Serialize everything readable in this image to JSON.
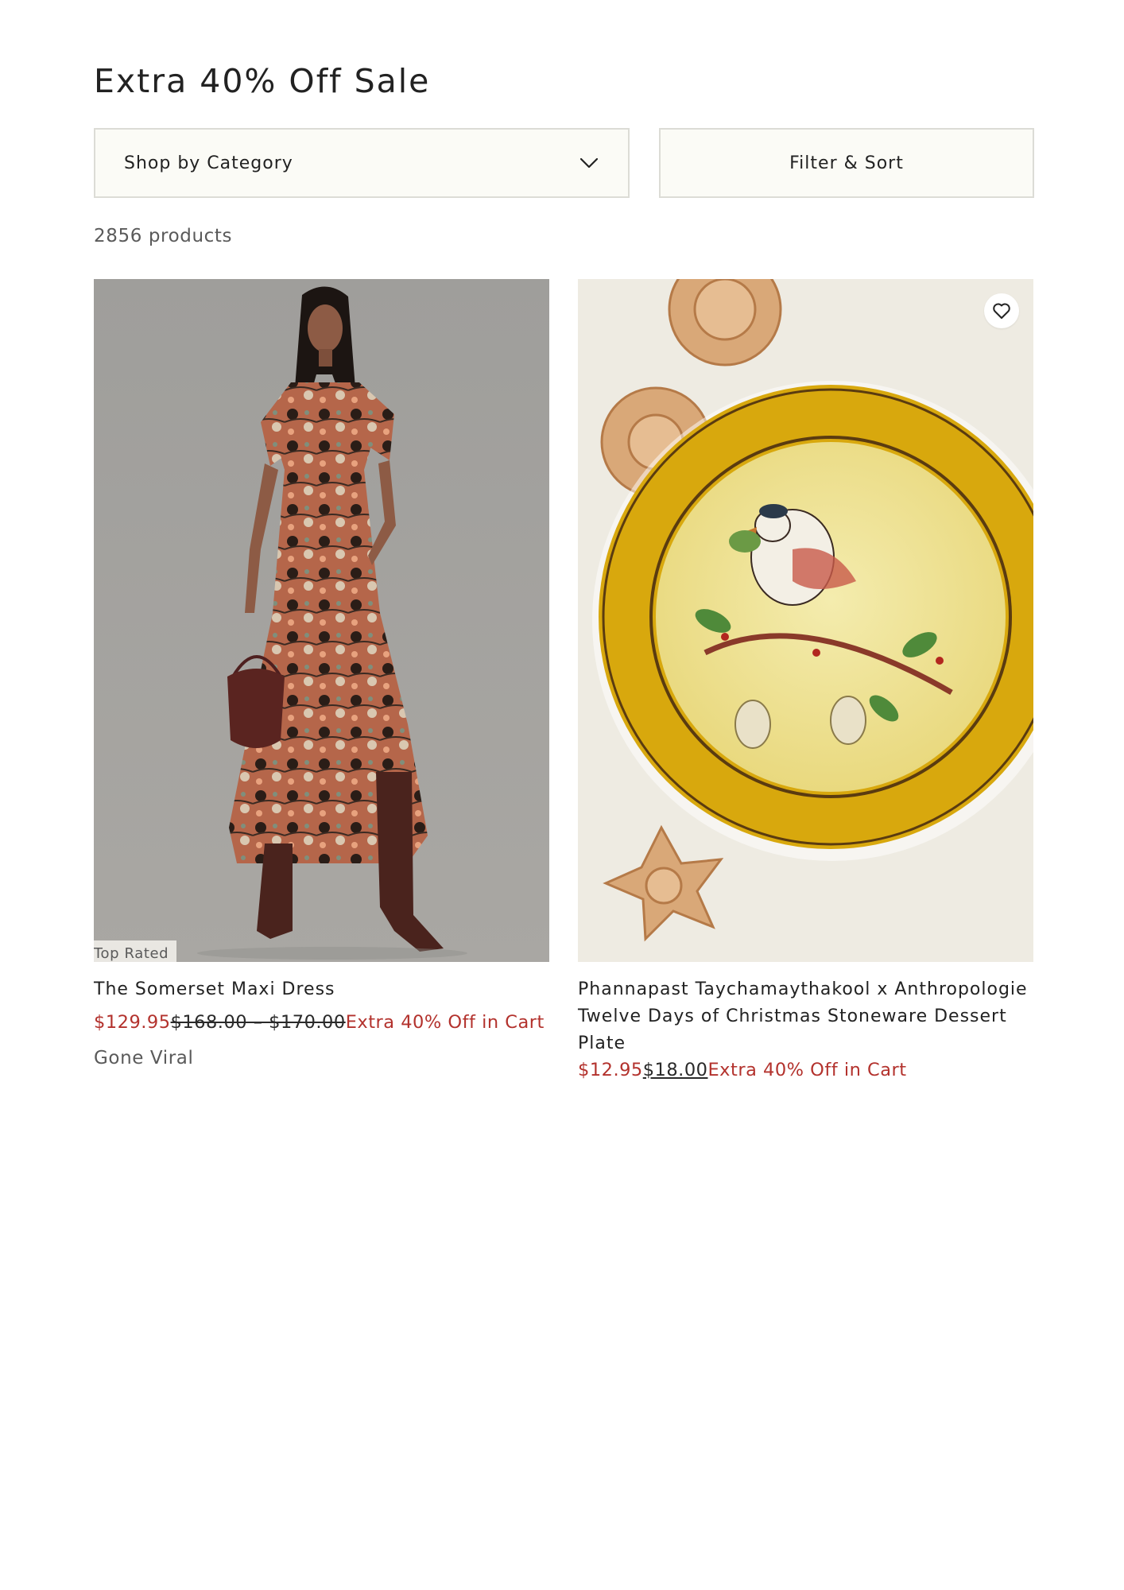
{
  "page": {
    "title": "Extra 40% Off Sale",
    "product_count": "2856 products"
  },
  "toolbar": {
    "category_label": "Shop by Category",
    "category_icon": "chevron-down-icon",
    "filter_label": "Filter & Sort"
  },
  "products": [
    {
      "badge": "Top Rated",
      "title": "The Somerset Maxi Dress",
      "sale_price": "$129.95",
      "original_price": "$168.00 – $170.00",
      "promo": "Extra 40% Off in Cart",
      "tag": "Gone Viral"
    },
    {
      "title": "Phannapast Taychamaythakool x Anthropologie Twelve Days of Christmas Stoneware Dessert Plate",
      "sale_price": "$12.95",
      "original_price": "$18.00",
      "promo": "Extra 40% Off in Cart",
      "wishlist_icon": "heart-icon"
    }
  ],
  "colors": {
    "accent_sale": "#b3322d",
    "toolbar_bg": "#fbfbf6",
    "text": "#222222",
    "muted_text": "#5a5a5a"
  }
}
